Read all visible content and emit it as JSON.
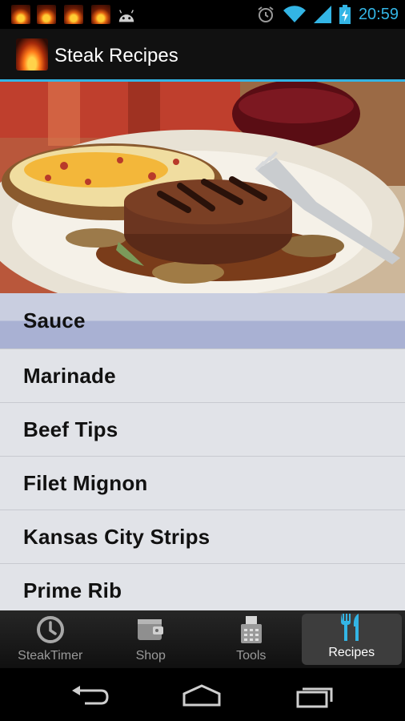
{
  "status_bar": {
    "time": "20:59",
    "notification_icons": [
      "steak-notification-icon",
      "steak-notification-icon",
      "steak-notification-icon",
      "steak-notification-icon",
      "android-icon"
    ],
    "status_icons": [
      "alarm-icon",
      "wifi-icon",
      "signal-icon",
      "battery-charging-icon"
    ]
  },
  "action_bar": {
    "title": "Steak Recipes",
    "accent_color": "#33b5e5"
  },
  "hero": {
    "image_subject": "steak-dinner-photo"
  },
  "recipes": {
    "items": [
      {
        "label": "Sauce",
        "selected": true
      },
      {
        "label": "Marinade",
        "selected": false
      },
      {
        "label": "Beef Tips",
        "selected": false
      },
      {
        "label": "Filet Mignon",
        "selected": false
      },
      {
        "label": "Kansas City Strips",
        "selected": false
      },
      {
        "label": "Prime Rib",
        "selected": false
      }
    ]
  },
  "tabs": [
    {
      "label": "SteakTimer",
      "icon": "clock-icon",
      "active": false
    },
    {
      "label": "Shop",
      "icon": "wallet-icon",
      "active": false
    },
    {
      "label": "Tools",
      "icon": "fax-icon",
      "active": false
    },
    {
      "label": "Recipes",
      "icon": "fork-knife-icon",
      "active": true
    }
  ],
  "nav_bar": {
    "buttons": [
      "back-icon",
      "home-icon",
      "recent-apps-icon"
    ]
  }
}
